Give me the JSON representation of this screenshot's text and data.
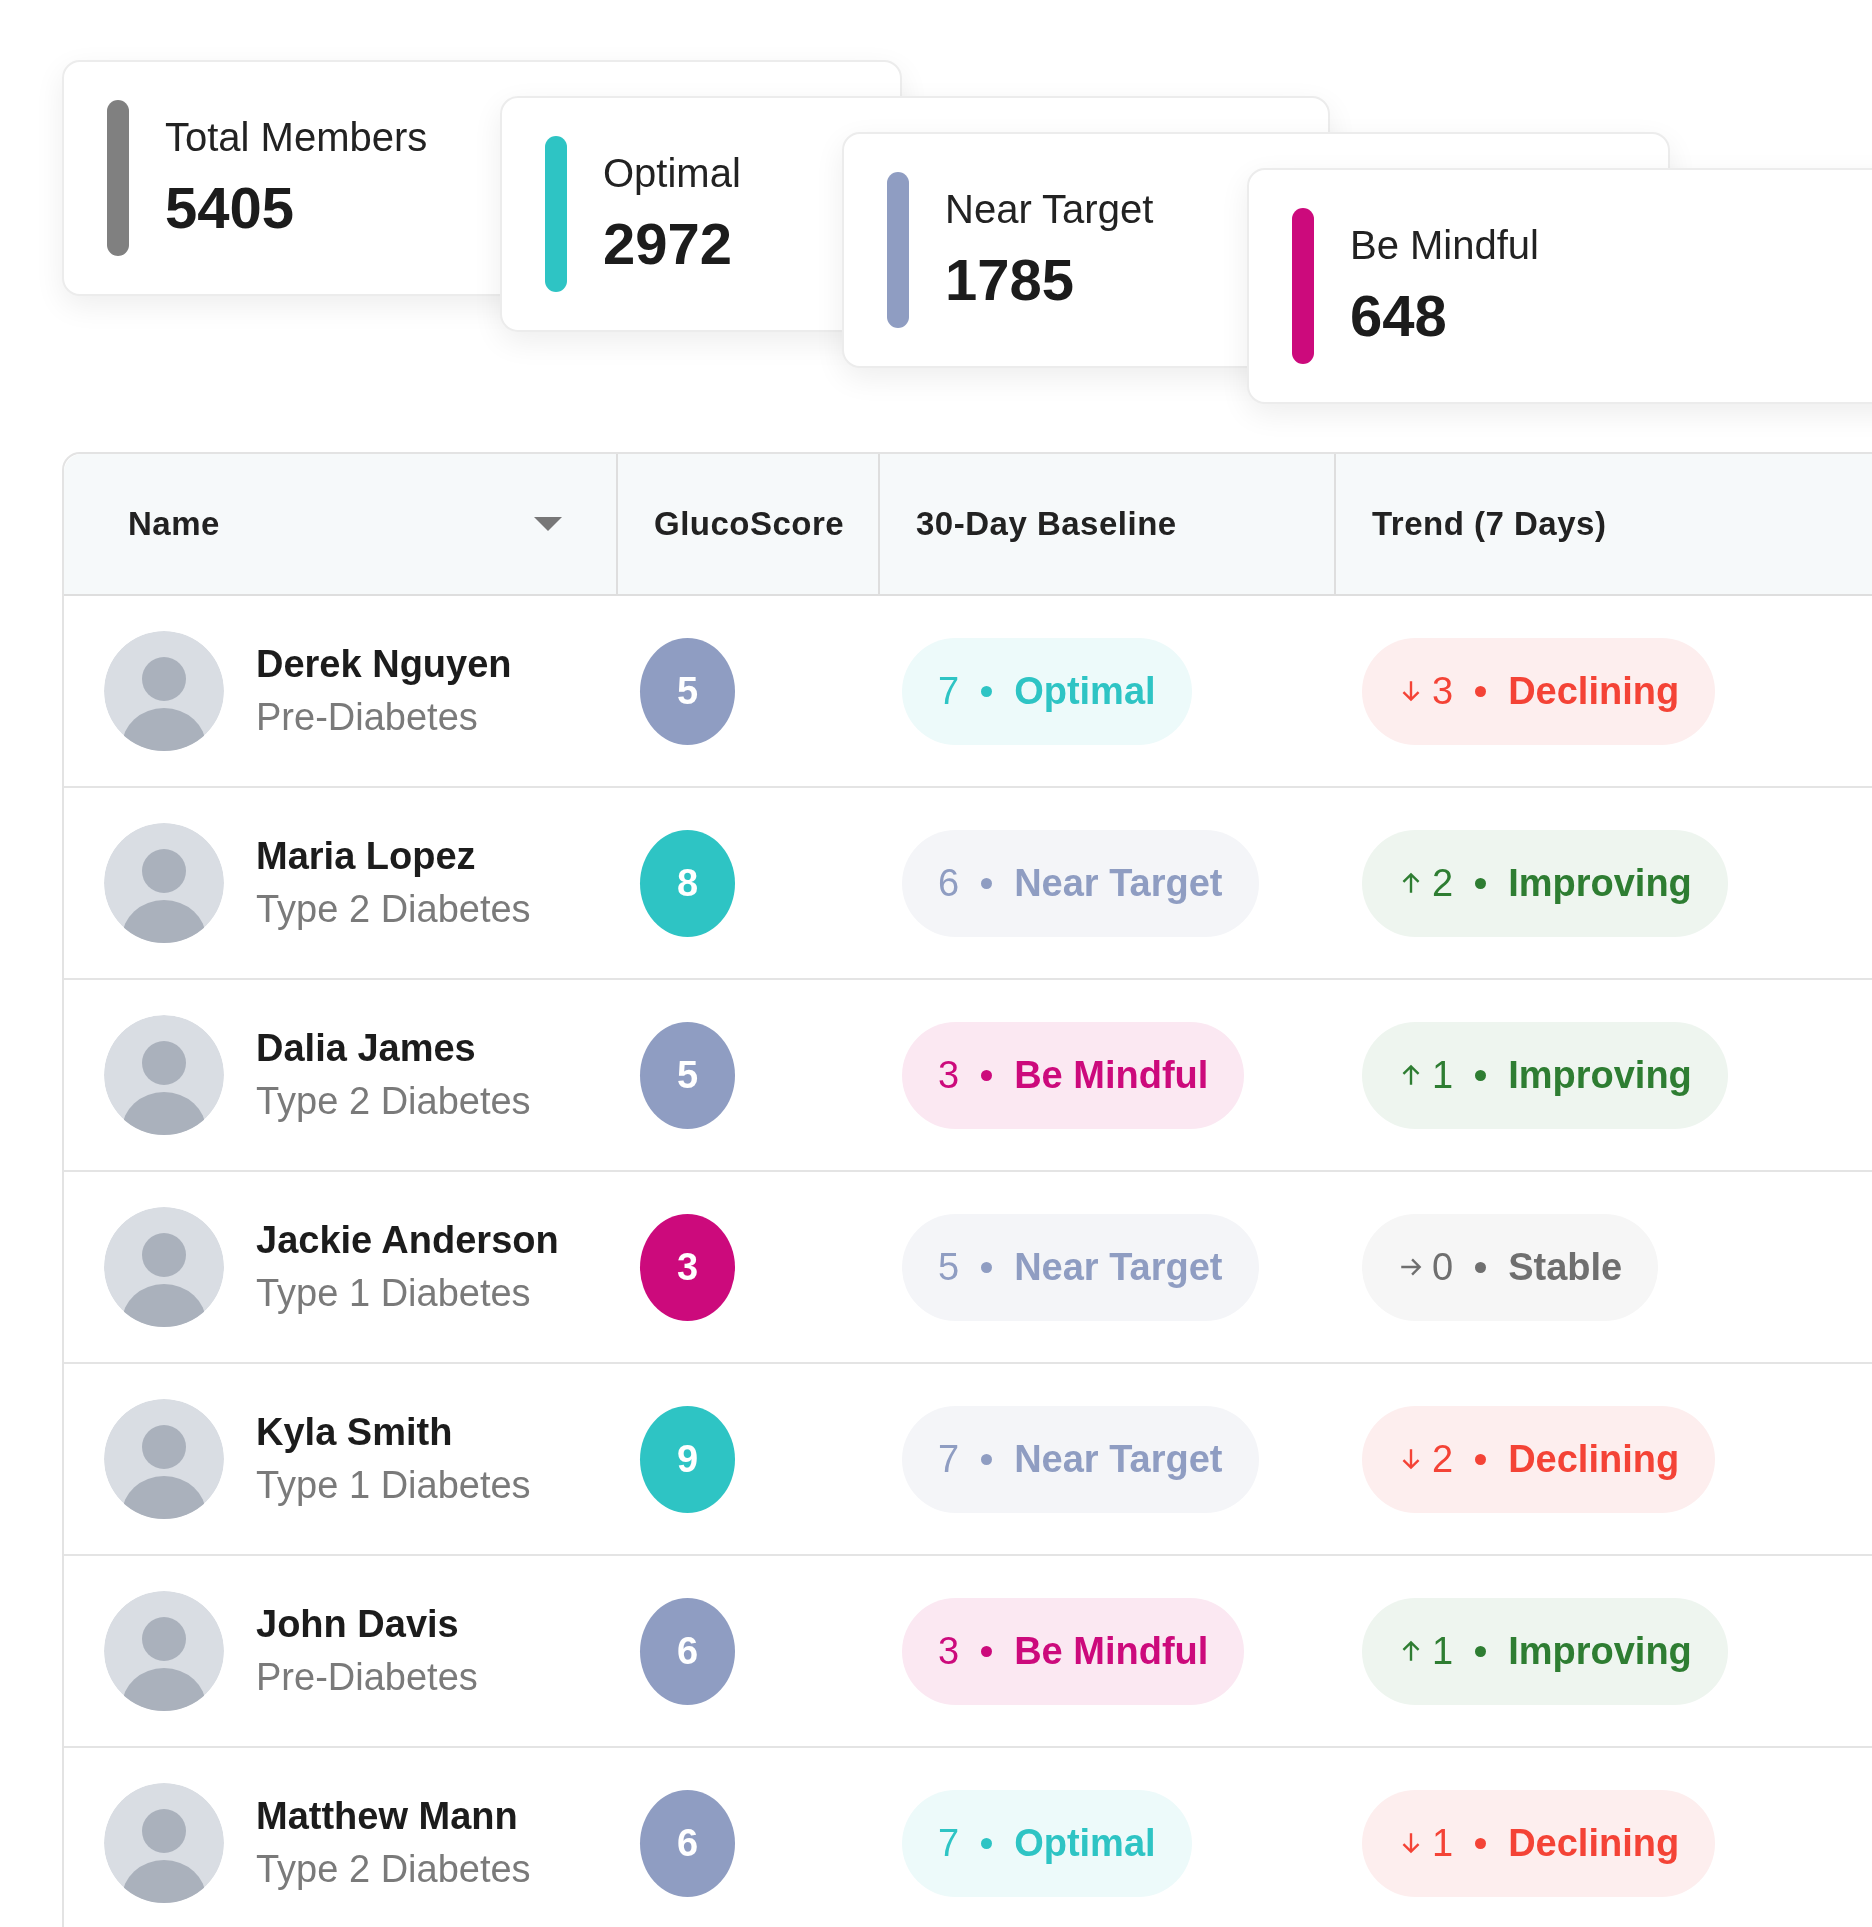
{
  "summary": [
    {
      "label": "Total Members",
      "value": "5405",
      "kind": "total"
    },
    {
      "label": "Optimal",
      "value": "2972",
      "kind": "optimal"
    },
    {
      "label": "Near Target",
      "value": "1785",
      "kind": "near"
    },
    {
      "label": "Be Mindful",
      "value": "648",
      "kind": "mindful"
    }
  ],
  "table": {
    "columns": [
      {
        "label": "Name",
        "sorted": true
      },
      {
        "label": "GlucoScore",
        "sorted": false
      },
      {
        "label": "30-Day Baseline",
        "sorted": false
      },
      {
        "label": "Trend (7 Days)",
        "sorted": false
      }
    ],
    "rows": [
      {
        "name": "Derek Nguyen",
        "condition": "Pre-Diabetes",
        "score": {
          "value": "5",
          "kind": "near"
        },
        "baseline": {
          "value": "7",
          "label": "Optimal",
          "kind": "optimal"
        },
        "trend": {
          "value": "3",
          "label": "Declining",
          "kind": "declining"
        }
      },
      {
        "name": "Maria Lopez",
        "condition": "Type 2 Diabetes",
        "score": {
          "value": "8",
          "kind": "optimal"
        },
        "baseline": {
          "value": "6",
          "label": "Near Target",
          "kind": "near"
        },
        "trend": {
          "value": "2",
          "label": "Improving",
          "kind": "improving"
        }
      },
      {
        "name": "Dalia James",
        "condition": "Type 2 Diabetes",
        "score": {
          "value": "5",
          "kind": "near"
        },
        "baseline": {
          "value": "3",
          "label": "Be Mindful",
          "kind": "mindful"
        },
        "trend": {
          "value": "1",
          "label": "Improving",
          "kind": "improving"
        }
      },
      {
        "name": "Jackie Anderson",
        "condition": "Type 1 Diabetes",
        "score": {
          "value": "3",
          "kind": "mindful"
        },
        "baseline": {
          "value": "5",
          "label": "Near Target",
          "kind": "near"
        },
        "trend": {
          "value": "0",
          "label": "Stable",
          "kind": "stable"
        }
      },
      {
        "name": "Kyla Smith",
        "condition": "Type 1 Diabetes",
        "score": {
          "value": "9",
          "kind": "optimal"
        },
        "baseline": {
          "value": "7",
          "label": "Near Target",
          "kind": "near"
        },
        "trend": {
          "value": "2",
          "label": "Declining",
          "kind": "declining"
        }
      },
      {
        "name": "John Davis",
        "condition": "Pre-Diabetes",
        "score": {
          "value": "6",
          "kind": "near"
        },
        "baseline": {
          "value": "3",
          "label": "Be Mindful",
          "kind": "mindful"
        },
        "trend": {
          "value": "1",
          "label": "Improving",
          "kind": "improving"
        }
      },
      {
        "name": "Matthew Mann",
        "condition": "Type 2 Diabetes",
        "score": {
          "value": "6",
          "kind": "near"
        },
        "baseline": {
          "value": "7",
          "label": "Optimal",
          "kind": "optimal"
        },
        "trend": {
          "value": "1",
          "label": "Declining",
          "kind": "declining"
        }
      }
    ]
  }
}
